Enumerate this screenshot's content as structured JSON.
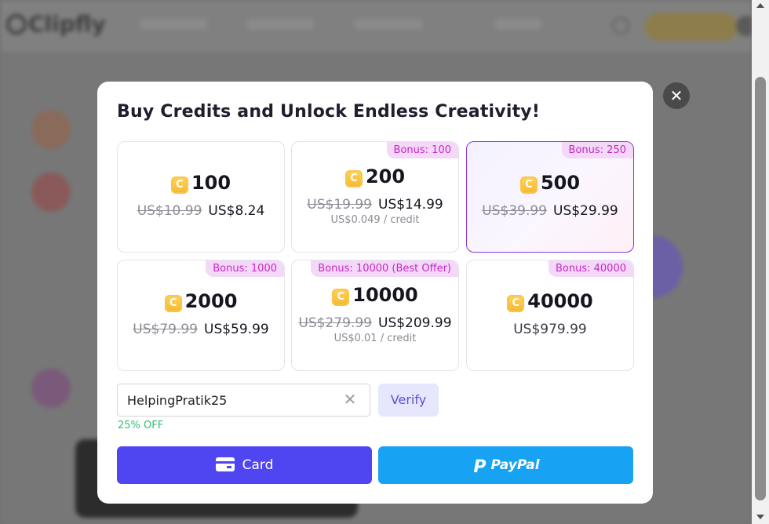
{
  "background": {
    "logo_text": "Clipfly"
  },
  "modal": {
    "title": "Buy Credits and Unlock Endless Creativity!",
    "close_symbol": "✕",
    "plans": [
      {
        "credits": "100",
        "old_price": "US$10.99",
        "new_price": "US$8.24",
        "per_credit": "",
        "bonus": "",
        "selected": false
      },
      {
        "credits": "200",
        "old_price": "US$19.99",
        "new_price": "US$14.99",
        "per_credit": "US$0.049 / credit",
        "bonus": "Bonus: 100",
        "selected": false
      },
      {
        "credits": "500",
        "old_price": "US$39.99",
        "new_price": "US$29.99",
        "per_credit": "",
        "bonus": "Bonus: 250",
        "selected": true
      },
      {
        "credits": "2000",
        "old_price": "US$79.99",
        "new_price": "US$59.99",
        "per_credit": "",
        "bonus": "Bonus: 1000",
        "selected": false
      },
      {
        "credits": "10000",
        "old_price": "US$279.99",
        "new_price": "US$209.99",
        "per_credit": "US$0.01 / credit",
        "bonus": "Bonus: 10000 (Best Offer)",
        "selected": false
      },
      {
        "credits": "40000",
        "old_price": "",
        "new_price": "US$979.99",
        "per_credit": "",
        "bonus": "Bonus: 40000",
        "selected": false
      }
    ],
    "coin_glyph": "C",
    "coupon": {
      "value": "HelpingPratik25",
      "clear_symbol": "✕",
      "verify_label": "Verify",
      "discount_text": "25% OFF"
    },
    "payment": {
      "card_label": "Card",
      "paypal_label": "PayPal",
      "paypal_glyph": "P"
    }
  },
  "colors": {
    "primary": "#5046f1",
    "paypal": "#17a2f4",
    "bonus_text": "#c727c9",
    "discount": "#2fbf71",
    "selected_border": "#8a38d6"
  }
}
